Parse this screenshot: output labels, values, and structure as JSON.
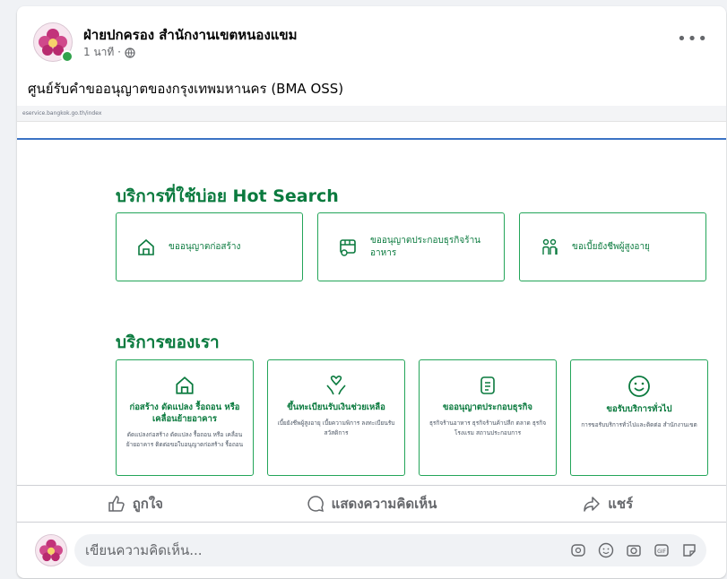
{
  "post": {
    "page_name": "ฝ่ายปกครอง สำนักงานเขตหนองแขม",
    "time": "1 นาที ·",
    "more_label": "•••",
    "text": "ศูนย์รับคำขออนุญาตของกรุงเทพมหานคร (BMA OSS)"
  },
  "screenshot": {
    "url": "eservice.bangkok.go.th/index",
    "hot_title": "บริการที่ใช้บ่อย Hot Search",
    "hot": [
      {
        "label": "ขออนุญาตก่อสร้าง",
        "icon": "house-icon"
      },
      {
        "label": "ขออนุญาตประกอบธุรกิจร้านอาหาร",
        "icon": "food-shop-icon"
      },
      {
        "label": "ขอเบี้ยยังชีพผู้สูงอายุ",
        "icon": "elderly-icon"
      }
    ],
    "services_title": "บริการของเรา",
    "services": [
      {
        "title": "ก่อสร้าง ดัดแปลง รื้อถอน หรือเคลื่อนย้ายอาคาร",
        "desc": "ดัดแปลงก่อสร้าง ดัดแปลง รื้อถอน หรือ เคลื่อนย้ายอาคาร ติดต่อขอใบอนุญาตก่อสร้าง รื้อถอน",
        "icon": "house-icon"
      },
      {
        "title": "ขึ้นทะเบียนรับเงินช่วยเหลือ",
        "desc": "เบี้ยยังชีพผู้สูงอายุ เบี้ยความพิการ ลงทะเบียนรับสวัสดิการ",
        "icon": "heart-hands-icon"
      },
      {
        "title": "ขออนุญาตประกอบธุรกิจ",
        "desc": "ธุรกิจร้านอาหาร ธุรกิจร้านค้าปลีก ตลาด ธุรกิจโรงแรม สถานประกอบการ",
        "icon": "document-icon"
      },
      {
        "title": "ขอรับบริการทั่วไป",
        "desc": "การขอรับบริการทั่วไปและติดต่อ สำนักงานเขต",
        "icon": "smile-icon"
      }
    ]
  },
  "actions": {
    "like": "ถูกใจ",
    "comment": "แสดงความคิดเห็น",
    "share": "แชร์"
  },
  "comment_box": {
    "placeholder": "เขียนความคิดเห็น..."
  },
  "colors": {
    "green": "#0a7a3e",
    "border_green": "#23a559"
  }
}
